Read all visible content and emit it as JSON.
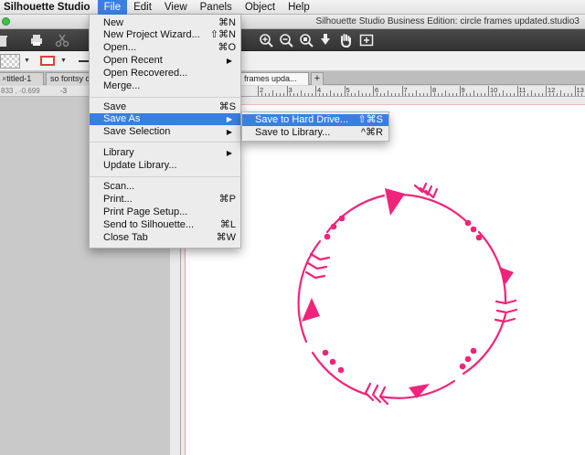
{
  "menubar": {
    "app_name": "Silhouette Studio",
    "items": [
      "File",
      "Edit",
      "View",
      "Panels",
      "Object",
      "Help"
    ],
    "active_item": "File"
  },
  "window": {
    "title": "Silhouette Studio Business Edition:  circle frames updated.studio3"
  },
  "tabs": [
    {
      "label": "titled-1"
    },
    {
      "label": "so fontsy c"
    },
    {
      "label": "frames upda..."
    }
  ],
  "coords": {
    "readout": "833 , -0.699",
    "ruler_tick": "-3"
  },
  "ruler": {
    "numbers": [
      "2",
      "3",
      "4",
      "5",
      "6",
      "7",
      "8",
      "9",
      "10",
      "11",
      "12",
      "13"
    ]
  },
  "file_menu": {
    "items": [
      {
        "label": "New",
        "shortcut": "⌘N"
      },
      {
        "label": "New Project Wizard...",
        "shortcut": "⇧⌘N"
      },
      {
        "label": "Open...",
        "shortcut": "⌘O"
      },
      {
        "label": "Open Recent",
        "submenu": true
      },
      {
        "label": "Open Recovered..."
      },
      {
        "label": "Merge..."
      },
      {
        "label": "Save",
        "shortcut": "⌘S"
      },
      {
        "label": "Save As",
        "submenu": true,
        "highlighted": true
      },
      {
        "label": "Save Selection",
        "submenu": true
      },
      {
        "label": "Library",
        "submenu": true
      },
      {
        "label": "Update Library..."
      },
      {
        "label": "Scan..."
      },
      {
        "label": "Print...",
        "shortcut": "⌘P"
      },
      {
        "label": "Print Page Setup..."
      },
      {
        "label": "Send to Silhouette...",
        "shortcut": "⌘L"
      },
      {
        "label": "Close Tab",
        "shortcut": "⌘W"
      }
    ],
    "submenu_arrow": "▶"
  },
  "save_as_submenu": {
    "items": [
      {
        "label": "Save to Hard Drive...",
        "shortcut": "⇧⌘S",
        "highlighted": true
      },
      {
        "label": "Save to Library...",
        "shortcut": "^⌘R"
      }
    ]
  },
  "design": {
    "description_color": "#f0247a",
    "shape": "circle-arrows-frame"
  },
  "colors": {
    "accent": "#3a7ee4",
    "design_pink": "#f0247a",
    "toolbar_dark": "#3a3a3a"
  },
  "toolbar_icons": [
    "trash-icon",
    "print-icon",
    "cut-icon",
    "zoom-in-icon",
    "zoom-out-icon",
    "zoom-selection-icon",
    "move-down-icon",
    "pan-hand-icon",
    "fit-page-icon"
  ]
}
